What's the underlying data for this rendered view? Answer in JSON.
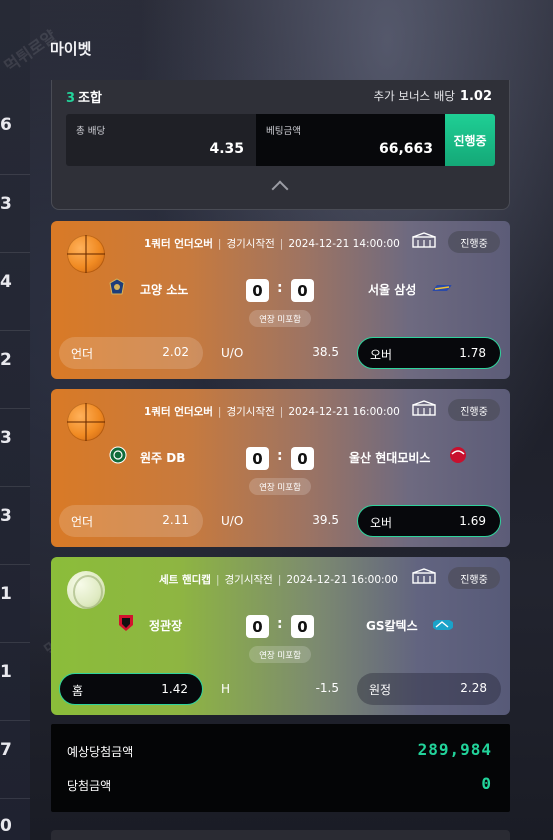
{
  "left_numbers": [
    "6",
    "3",
    "4",
    "2",
    "3",
    "3",
    "1",
    "1",
    "7",
    "0"
  ],
  "watermark_text": "먹튀로얄",
  "page_title": "마이벳",
  "summary": {
    "combo_count": "3",
    "combo_label": "조합",
    "bonus_label": "추가 보너스 배당",
    "bonus_value": "1.02",
    "total_odds_label": "총 배당",
    "total_odds_value": "4.35",
    "bet_amount_label": "베팅금액",
    "bet_amount_value": "66,663",
    "status_label": "진행중"
  },
  "bets": [
    {
      "sport_icon": "basketball-icon",
      "type": "1쿼터 언더오버",
      "status_text": "경기시작전",
      "datetime": "2024-12-21 14:00:00",
      "state": "진행중",
      "home_team": "고양 소노",
      "away_team": "서울 삼성",
      "home_score": "0",
      "away_score": "0",
      "overtime_note": "연장 미포함",
      "left_label": "언더",
      "left_odds": "2.02",
      "mid_label": "U/O",
      "mid_value": "38.5",
      "right_label": "오버",
      "right_odds": "1.78",
      "selected": "right"
    },
    {
      "sport_icon": "basketball-icon",
      "type": "1쿼터 언더오버",
      "status_text": "경기시작전",
      "datetime": "2024-12-21 16:00:00",
      "state": "진행중",
      "home_team": "원주 DB",
      "away_team": "울산 현대모비스",
      "home_score": "0",
      "away_score": "0",
      "overtime_note": "연장 미포함",
      "left_label": "언더",
      "left_odds": "2.11",
      "mid_label": "U/O",
      "mid_value": "39.5",
      "right_label": "오버",
      "right_odds": "1.69",
      "selected": "right"
    },
    {
      "sport_icon": "volleyball-icon",
      "type": "세트 핸디캡",
      "status_text": "경기시작전",
      "datetime": "2024-12-21 16:00:00",
      "state": "진행중",
      "home_team": "정관장",
      "away_team": "GS칼텍스",
      "home_score": "0",
      "away_score": "0",
      "overtime_note": "연장 미포함",
      "left_label": "홈",
      "left_odds": "1.42",
      "mid_label": "H",
      "mid_value": "-1.5",
      "right_label": "원정",
      "right_odds": "2.28",
      "selected": "left"
    }
  ],
  "totals": {
    "expected_label": "예상당첨금액",
    "expected_value": "289,984",
    "won_label": "당첨금액",
    "won_value": "0"
  },
  "colors": {
    "accent_green": "#22d39a",
    "basketball_card": "#d97a26",
    "volleyball_card": "#8bbd3a"
  }
}
